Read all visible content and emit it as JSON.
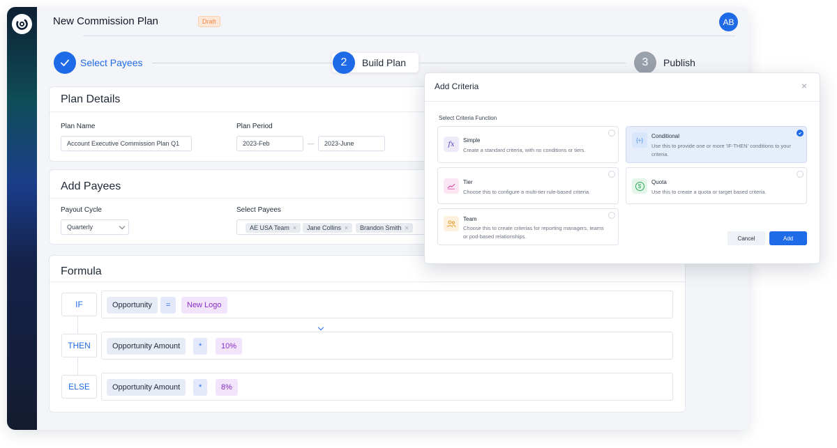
{
  "header": {
    "title": "New Commission Plan",
    "status_badge": "Draft",
    "avatar_initials": "AB"
  },
  "stepper": {
    "steps": [
      {
        "number": "",
        "label": "Select Payees",
        "state": "done"
      },
      {
        "number": "2",
        "label": "Build Plan",
        "state": "current"
      },
      {
        "number": "3",
        "label": "Publish",
        "state": "upcoming"
      }
    ]
  },
  "plan_details": {
    "title": "Plan Details",
    "plan_name_label": "Plan Name",
    "plan_name_value": "Account Executive Commission Plan Q1",
    "plan_period_label": "Plan Period",
    "period_start": "2023-Feb",
    "period_separator": "—",
    "period_end": "2023-June"
  },
  "add_payees": {
    "title": "Add Payees",
    "payout_cycle_label": "Payout Cycle",
    "payout_cycle_value": "Quarterly",
    "select_payees_label": "Select Payees",
    "chips": [
      "AE USA Team",
      "Jane Collins",
      "Brandon Smith"
    ],
    "chip_remove": "×"
  },
  "formula": {
    "title": "Formula",
    "rows": [
      {
        "key": "IF",
        "field": "Opportunity",
        "op": "=",
        "value": "New Logo"
      },
      {
        "key": "THEN",
        "field": "Opportunity Amount",
        "op": "*",
        "value": "10%"
      },
      {
        "key": "ELSE",
        "field": "Opportunity Amount",
        "op": "*",
        "value": "8%"
      }
    ]
  },
  "modal": {
    "title": "Add Criteria",
    "close": "×",
    "section_label": "Select Criteria Function",
    "options": [
      {
        "title": "Simple",
        "icon": "fx",
        "desc": "Create a standard criteria, with no conditions or tiers.",
        "selected": false
      },
      {
        "title": "Conditional",
        "icon": "{+}",
        "desc": "Use this to provide one or more 'IF-THEN' conditions to your criteria.",
        "selected": true
      },
      {
        "title": "Tier",
        "icon": "tier-icon",
        "desc": "Choose this to configure a multi-tier rule-based criteria.",
        "selected": false
      },
      {
        "title": "Quota",
        "icon": "$",
        "desc": "Use this to create a quota or target based criteria.",
        "selected": false
      },
      {
        "title": "Team",
        "icon": "team-icon",
        "desc": "Choose this to create criterias for reporting managers, teams or pod-based relationships.",
        "selected": false
      }
    ],
    "cancel_label": "Cancel",
    "add_label": "Add"
  },
  "colors": {
    "primary": "#1f6ae6",
    "draft": "#f08a4b",
    "value_token": "#8a2cc7"
  }
}
